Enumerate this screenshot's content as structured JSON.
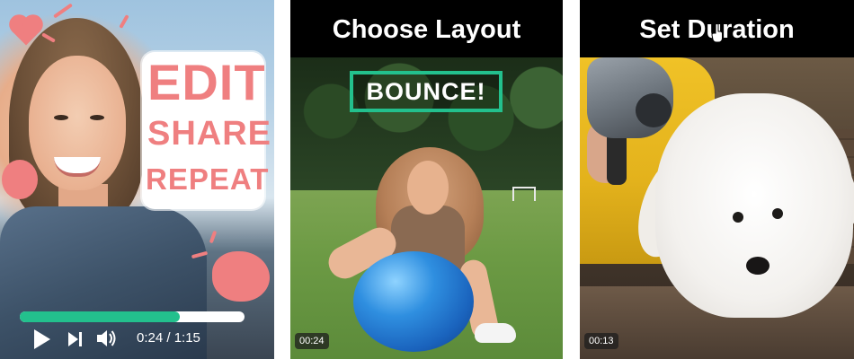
{
  "panels": [
    {
      "id": "edit-share-repeat",
      "sticker_lines": [
        "EDIT",
        "SHARE",
        "REPEAT"
      ],
      "player": {
        "progress_fraction": 0.71,
        "current_time": "0:24",
        "total_time": "1:15",
        "time_display": "0:24 / 1:15"
      }
    },
    {
      "id": "choose-layout",
      "title": "Choose Layout",
      "badge_text": "BOUNCE!",
      "duration": "00:24"
    },
    {
      "id": "set-duration",
      "title": "Set Duration",
      "duration": "00:13"
    }
  ],
  "colors": {
    "accent_green": "#23c08d",
    "sticker_pink": "#ef7f80",
    "header_black": "#000000"
  },
  "icons": {
    "play": "play-icon",
    "next": "skip-next-icon",
    "volume": "volume-icon",
    "cursor": "hand-cursor-icon"
  }
}
